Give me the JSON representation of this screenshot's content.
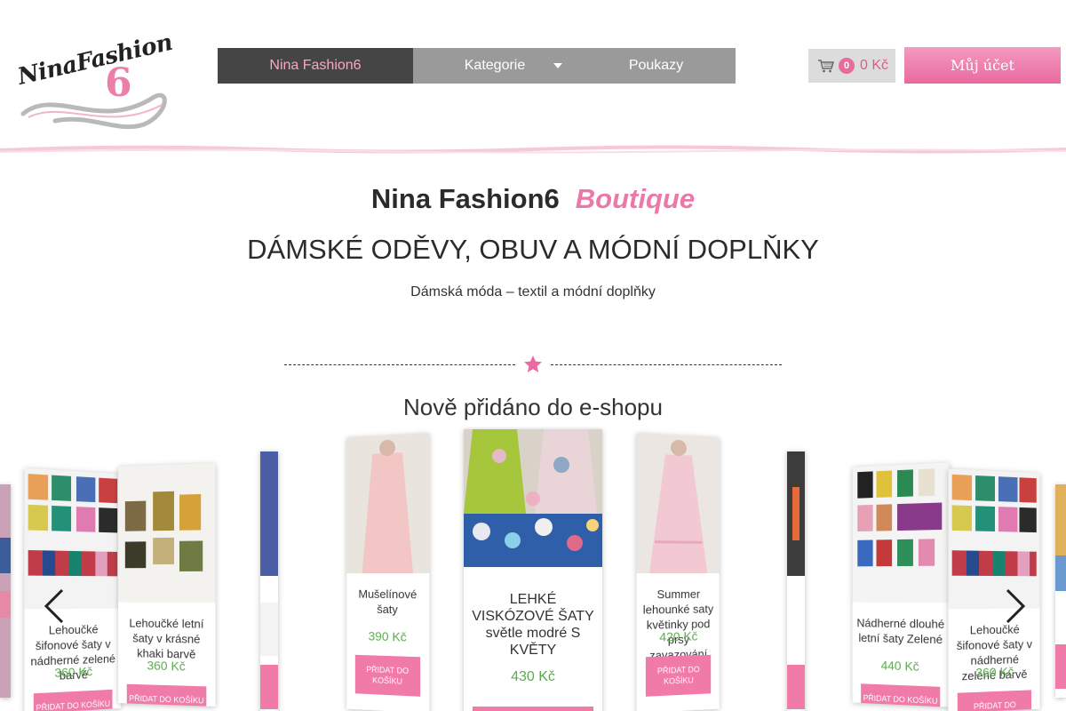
{
  "logo": {
    "text": "NinaFashion",
    "number": "6"
  },
  "nav": {
    "home": "Nina Fashion6",
    "categories": "Kategorie",
    "vouchers": "Poukazy"
  },
  "cart": {
    "count": "0",
    "total": "0 Kč"
  },
  "account": {
    "label": "Můj účet"
  },
  "hero": {
    "title": "Nina Fashion6",
    "title_accent": "Boutique",
    "subtitle": "DÁMSKÉ ODĚVY, OBUV A MÓDNÍ DOPLŇKY",
    "description": "Dámská móda – textil a módní doplňky"
  },
  "section": {
    "title": "Nově přidáno do e-shopu"
  },
  "products": [
    {
      "name": "Lehoučké šifonové šaty v nádherné zelené barvě",
      "price": "360 Kč",
      "button": "PŘIDAT DO KOŠÍKU"
    },
    {
      "name": "Lehoučké letní šaty v krásné khaki barvě",
      "price": "360 Kč",
      "button": "PŘIDAT DO KOŠÍKU"
    },
    {
      "name": " Mušelínové šaty ",
      "price": "390 Kč",
      "button": "PŘIDAT DO KOŠÍKU"
    },
    {
      "name": " LEHKÉ VISKÓZOVÉ ŠATY světle modré S KVĚTY ",
      "price": "430 Kč",
      "button": "PŘIDAT DO KOŠÍKU"
    },
    {
      "name": "Summer lehounké saty květinky pod prsy zavazování",
      "price": "420 Kč",
      "button": "PŘIDAT DO KOŠÍKU"
    },
    {
      "name": "Nádherné dlouhé letní šaty  Zelené",
      "price": "440 Kč",
      "button": "PŘIDAT DO KOŠÍKU"
    },
    {
      "name": "Lehoučké šifonové šaty v nádherné zelené barvě",
      "price": "360 Kč",
      "button": "PŘIDAT DO KOŠÍKU"
    }
  ],
  "colors": {
    "accent_pink": "#ea79a8",
    "nav_dark": "#454545",
    "nav_grey": "#9a9a9a",
    "price_green": "#5cab4e"
  },
  "icons": [
    "cart-icon",
    "chevron-down-icon",
    "star-icon",
    "chevron-left-icon",
    "chevron-right-icon"
  ]
}
